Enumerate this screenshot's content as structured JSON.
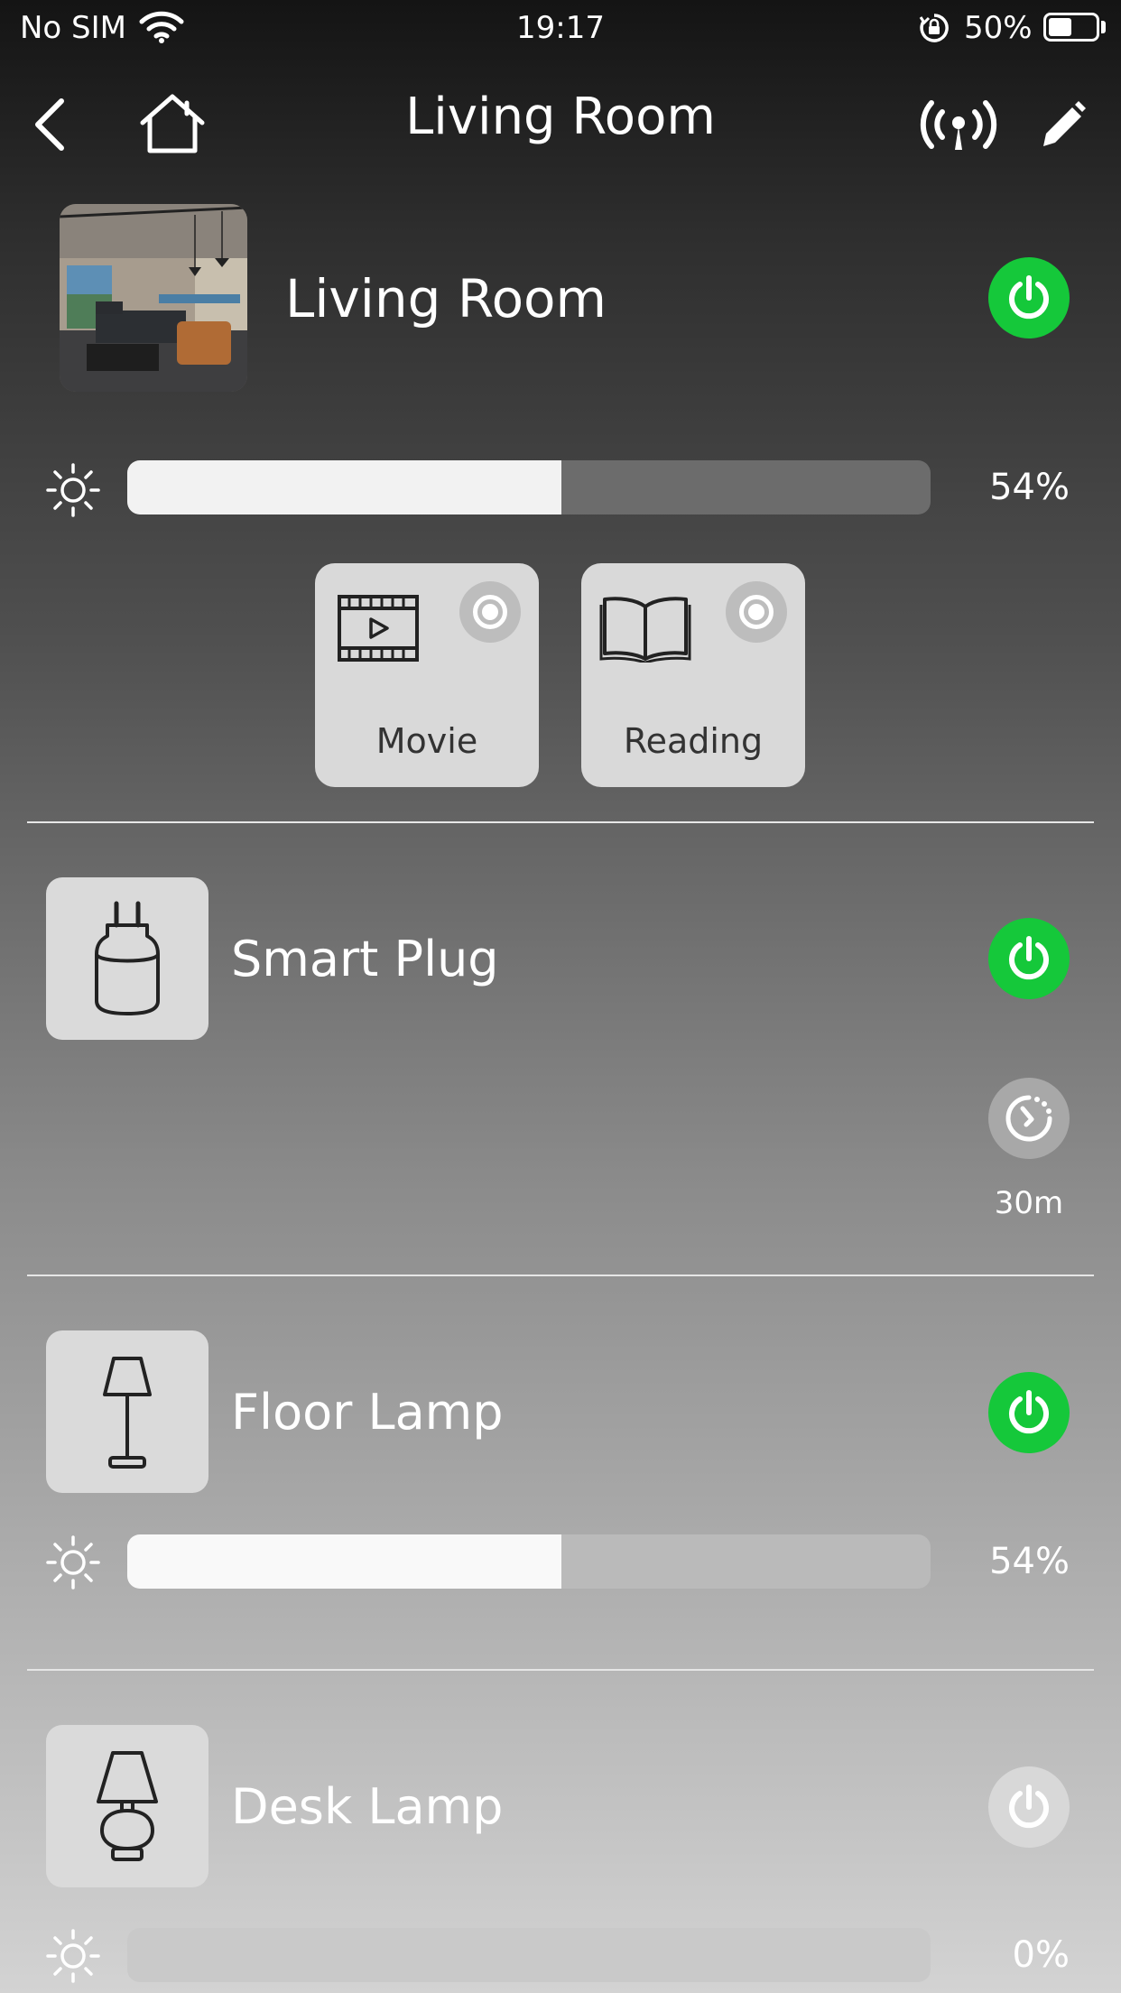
{
  "status_bar": {
    "carrier": "No SIM",
    "time": "19:17",
    "battery": "50%",
    "battery_level": 0.5
  },
  "nav": {
    "title": "Living Room",
    "back_icon": "chevron-left-icon",
    "home_icon": "home-icon",
    "signal_icon": "broadcast-icon",
    "edit_icon": "pencil-icon"
  },
  "room": {
    "name": "Living Room",
    "power_on": true,
    "brightness_label": "54%",
    "brightness": 0.54
  },
  "scenes": [
    {
      "label": "Movie",
      "icon": "film-icon"
    },
    {
      "label": "Reading",
      "icon": "book-icon"
    }
  ],
  "devices": {
    "smart_plug": {
      "name": "Smart Plug",
      "power_on": true,
      "timer_label": "30m",
      "icon": "plug-icon"
    },
    "floor_lamp": {
      "name": "Floor Lamp",
      "power_on": true,
      "brightness_label": "54%",
      "brightness": 0.54,
      "icon": "floor-lamp-icon"
    },
    "desk_lamp": {
      "name": "Desk Lamp",
      "power_on": false,
      "brightness_label": "0%",
      "brightness": 0,
      "icon": "desk-lamp-icon"
    }
  },
  "colors": {
    "power_on": "#15c83a",
    "power_off": "#d8d8d8"
  }
}
